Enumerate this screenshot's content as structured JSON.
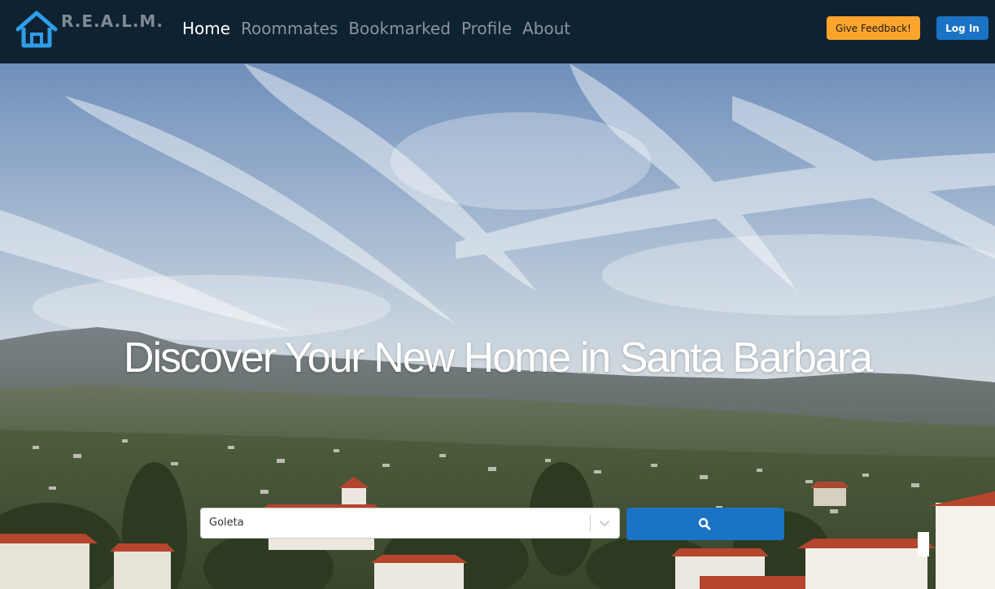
{
  "app": {
    "logo_text": "R.E.A.L.M.",
    "logo_icon": "house-icon"
  },
  "nav": {
    "items": [
      {
        "label": "Home",
        "active": true
      },
      {
        "label": "Roommates",
        "active": false
      },
      {
        "label": "Bookmarked",
        "active": false
      },
      {
        "label": "Profile",
        "active": false
      },
      {
        "label": "About",
        "active": false
      }
    ],
    "feedback_label": "Give Feedback!",
    "login_label": "Log In"
  },
  "hero": {
    "title": "Discover Your New Home in Santa Barbara"
  },
  "search": {
    "selected_location": "Goleta",
    "chevron_icon": "chevron-down-icon",
    "button_icon": "search-icon"
  },
  "colors": {
    "navbar_bg": "#0f2232",
    "logo_blue": "#2f9ee8",
    "feedback_orange": "#fca52c",
    "primary_blue": "#1a73c4"
  }
}
